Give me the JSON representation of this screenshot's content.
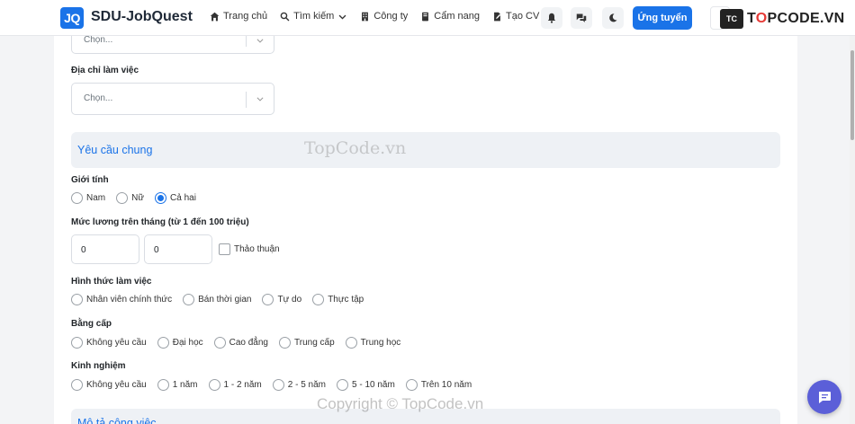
{
  "header": {
    "logo_text": "JQ",
    "brand": "SDU-JobQuest",
    "nav": [
      {
        "label": "Trang chủ",
        "icon": "home-icon"
      },
      {
        "label": "Tìm kiếm",
        "icon": "search-icon"
      },
      {
        "label": "Công ty",
        "icon": "building-icon"
      },
      {
        "label": "Cẩm nang",
        "icon": "book-icon"
      },
      {
        "label": "Tạo CV",
        "icon": "file-edit-icon"
      }
    ],
    "apply_label": "Ứng tuyển"
  },
  "watermarks": {
    "logo_mark": "TC",
    "logo_text_pre": "T",
    "logo_text_o": "O",
    "logo_text_post": "PCODE.VN",
    "center": "TopCode.vn",
    "bottom": "Copyright © TopCode.vn"
  },
  "form": {
    "top_select_placeholder": "Chọn...",
    "address": {
      "label": "Địa chỉ làm việc",
      "placeholder": "Chọn..."
    },
    "section_general": "Yêu cầu chung",
    "gender": {
      "label": "Giới tính",
      "options": [
        "Nam",
        "Nữ",
        "Cả hai"
      ],
      "selected": "Cả hai"
    },
    "salary": {
      "label": "Mức lương trên tháng (từ 1 đến 100 triệu)",
      "min": "0",
      "max": "0",
      "negotiable_label": "Thảo thuận"
    },
    "work_type": {
      "label": "Hình thức làm việc",
      "options": [
        "Nhân viên chính thức",
        "Bán thời gian",
        "Tự do",
        "Thực tập"
      ]
    },
    "degree": {
      "label": "Bằng cấp",
      "options": [
        "Không yêu cầu",
        "Đại học",
        "Cao đẳng",
        "Trung cấp",
        "Trung học"
      ]
    },
    "experience": {
      "label": "Kinh nghiệm",
      "options": [
        "Không yêu cầu",
        "1 năm",
        "1 - 2 năm",
        "2 - 5 năm",
        "5 - 10 năm",
        "Trên 10 năm"
      ]
    },
    "section_next": "Mô tả công việc"
  },
  "colors": {
    "accent": "#1a73e8",
    "chat_fab": "#5b5fd8"
  }
}
